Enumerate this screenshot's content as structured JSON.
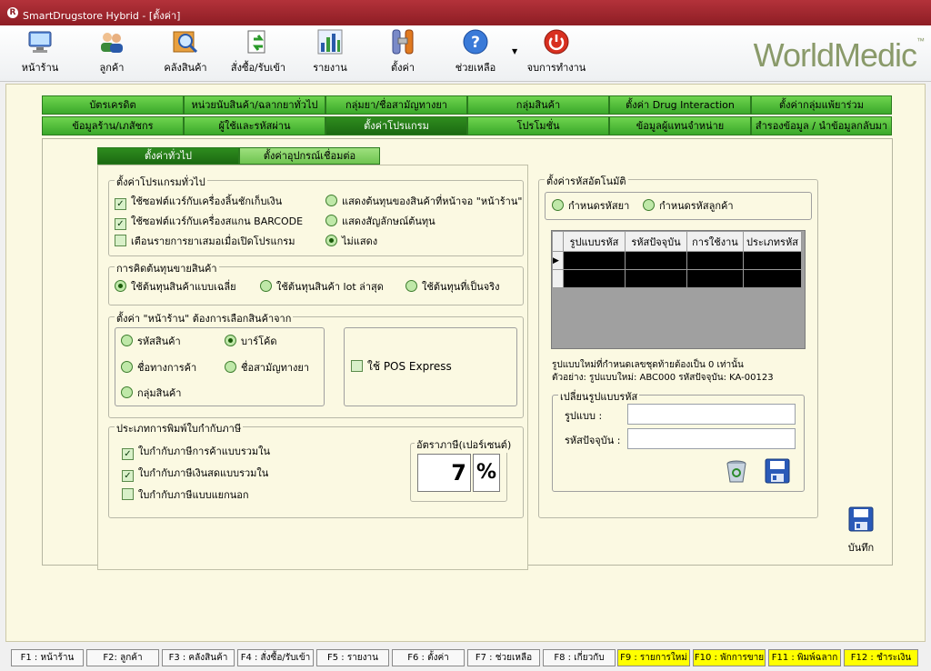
{
  "window": {
    "title": "SmartDrugstore Hybrid - [ตั้งค่า]"
  },
  "toolbar": {
    "items": [
      {
        "label": "หน้าร้าน",
        "icon": "monitor-icon"
      },
      {
        "label": "ลูกค้า",
        "icon": "customers-icon"
      },
      {
        "label": "คลังสินค้า",
        "icon": "inventory-search-icon"
      },
      {
        "label": "สั่งซื้อ/รับเข้า",
        "icon": "purchase-icon"
      },
      {
        "label": "รายงาน",
        "icon": "report-chart-icon"
      },
      {
        "label": "ตั้งค่า",
        "icon": "settings-tools-icon"
      },
      {
        "label": "ช่วยเหลือ",
        "icon": "help-icon"
      },
      {
        "label": "จบการทำงาน",
        "icon": "power-icon"
      }
    ],
    "brand": "WorldMedic",
    "brand_mark": "™"
  },
  "tabs_row1": [
    "บัตรเครดิต",
    "หน่วยนับสินค้า/ฉลากยาทั่วไป",
    "กลุ่มยา/ชื่อสามัญทางยา",
    "กลุ่มสินค้า",
    "ตั้งค่า Drug Interaction",
    "ตั้งค่ากลุ่มแพ้ยาร่วม"
  ],
  "tabs_row2": [
    "ข้อมูลร้าน/เภสัชกร",
    "ผู้ใช้และรหัสผ่าน",
    "ตั้งค่าโปรแกรม",
    "โปรโมชั่น",
    "ข้อมูลผู้แทนจำหน่าย",
    "สำรองข้อมูล / นำข้อมูลกลับมา"
  ],
  "selected_tab": "ตั้งค่าโปรแกรม",
  "subtabs": [
    "ตั้งค่าทั่วไป",
    "ตั้งค่าอุปกรณ์เชื่อมต่อ"
  ],
  "general": {
    "title": "ตั้งค่าโปรแกรมทั่วไป",
    "opt1": "ใช้ซอฟต์แวร์กับเครื่องลิ้นชักเก็บเงิน",
    "opt2": "ใช้ซอฟต์แวร์กับเครื่องสแกน BARCODE",
    "opt3": "เตือนรายการยาเสมอเมื่อเปิดโปรแกรม",
    "r1": "แสดงต้นทุนของสินค้าที่หน้าจอ \"หน้าร้าน\"",
    "r2": "แสดงสัญลักษณ์ต้นทุน",
    "r3": "ไม่แสดง"
  },
  "cost": {
    "title": "การคิดต้นทุนขายสินค้า",
    "r1": "ใช้ต้นทุนสินค้าแบบเฉลี่ย",
    "r2": "ใช้ต้นทุนสินค้า lot ล่าสุด",
    "r3": "ใช้ต้นทุนที่เป็นจริง"
  },
  "front": {
    "title": "ตั้งค่า \"หน้าร้าน\" ต้องการเลือกสินค้าจาก",
    "r1": "รหัสสินค้า",
    "r2": "บาร์โค้ด",
    "r3": "ชื่อทางการค้า",
    "r4": "ชื่อสามัญทางยา",
    "r5": "กลุ่มสินค้า",
    "pos": "ใช้ POS Express"
  },
  "tax": {
    "title": "ประเภทการพิมพ์ใบกำกับภาษี",
    "c1": "ใบกำกับภาษีการค้าแบบรวมใน",
    "c2": "ใบกำกับภาษีเงินสดแบบรวมใน",
    "c3": "ใบกำกับภาษีแบบแยกนอก",
    "rate_title": "อัตราภาษี(เปอร์เซนต์)",
    "rate": "7",
    "unit": "%"
  },
  "autocode": {
    "title": "ตั้งค่ารหัสอัตโนมัติ",
    "r1": "กำหนดรหัสยา",
    "r2": "กำหนดรหัสลูกค้า",
    "columns": [
      "รูปแบบรหัส",
      "รหัสปัจจุบัน",
      "การใช้งาน",
      "ประเภทรหัส"
    ],
    "note1": "รูปแบบใหม่ที่กำหนดเลขชุดท้ายต้องเป็น 0 เท่านั้น",
    "note2": "ตัวอย่าง: รูปแบบใหม่: ABC000 รหัสปัจจุบัน: KA-00123",
    "change_title": "เปลี่ยนรูปแบบรหัส",
    "format_label": "รูปแบบ :",
    "current_label": "รหัสปัจจุบัน :",
    "format_value": "",
    "current_value": ""
  },
  "save_label": "บันทึก",
  "fkeys": [
    {
      "label": "F1 : หน้าร้าน",
      "hl": false
    },
    {
      "label": "F2: ลูกค้า",
      "hl": false
    },
    {
      "label": "F3 : คลังสินค้า",
      "hl": false
    },
    {
      "label": "F4 : สั่งซื้อ/รับเข้า",
      "hl": false
    },
    {
      "label": "F5 : รายงาน",
      "hl": false
    },
    {
      "label": "F6 : ตั้งค่า",
      "hl": false
    },
    {
      "label": "F7 : ช่วยเหลือ",
      "hl": false
    },
    {
      "label": "F8 : เกี่ยวกับ",
      "hl": false
    },
    {
      "label": "F9 : รายการใหม่",
      "hl": true
    },
    {
      "label": "F10 : พักการขาย",
      "hl": true
    },
    {
      "label": "F11 : พิมพ์ฉลาก",
      "hl": true
    },
    {
      "label": "F12 : ชำระเงิน",
      "hl": true
    }
  ]
}
